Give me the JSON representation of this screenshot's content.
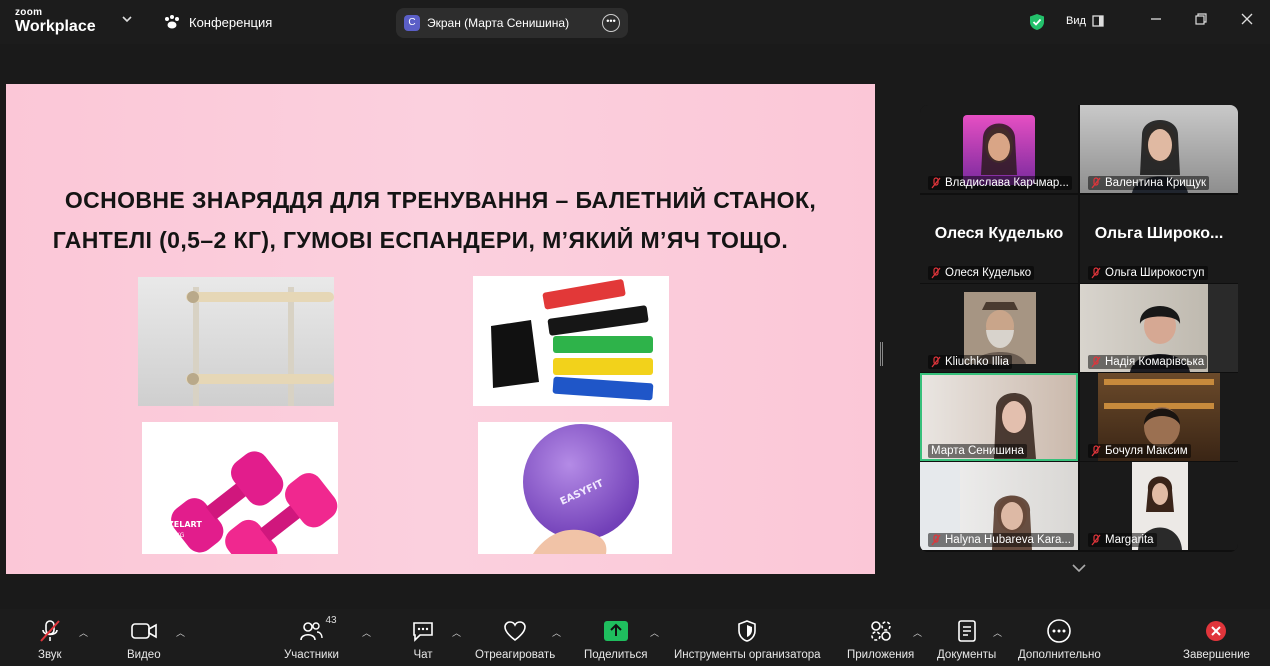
{
  "topbar": {
    "logo_small": "zoom",
    "logo_big": "Workplace",
    "meeting_label": "Конференция",
    "screen_badge": "С",
    "screen_label": "Экран (Марта Сенишина)",
    "view_label": "Вид"
  },
  "slide": {
    "title_line1": "ОСНОВНЕ ЗНАРЯДДЯ ДЛЯ ТРЕНУВАННЯ  – БАЛЕТНИЙ СТАНОК,",
    "title_line2": "ГАНТЕЛІ (0,5–2 КГ), ГУМОВІ ЕСПАНДЕРИ, М’ЯКИЙ М’ЯЧ ТОЩО.",
    "dumbbell_brand": "ZELART",
    "dumbbell_weight": "2KG",
    "ball_brand": "EASYFIT"
  },
  "participants": [
    {
      "name": "Владислава Карчмар..."
    },
    {
      "name": "Валентина Крищук"
    },
    {
      "name": "Олеся Куделько",
      "display": "Олеся Куделько"
    },
    {
      "name": "Ольга Широкоступ",
      "display": "Ольга  Широко..."
    },
    {
      "name": "Kliuchko Illia"
    },
    {
      "name": "Надія Комарівська"
    },
    {
      "name": "Марта Сенишина"
    },
    {
      "name": "Бочуля Максим"
    },
    {
      "name": "Halyna Hubareva Kara..."
    },
    {
      "name": "Margarita"
    }
  ],
  "toolbar": {
    "audio": "Звук",
    "video": "Видео",
    "participants": "Участники",
    "participants_count": "43",
    "chat": "Чат",
    "react": "Отреагировать",
    "share": "Поделиться",
    "host_tools": "Инструменты организатора",
    "apps": "Приложения",
    "docs": "Документы",
    "more": "Дополнительно",
    "end": "Завершение"
  },
  "colors": {
    "accent_green": "#37c07b",
    "share_green": "#1fbe5e",
    "end_red": "#e0353b",
    "muted_red": "#e0353b"
  }
}
